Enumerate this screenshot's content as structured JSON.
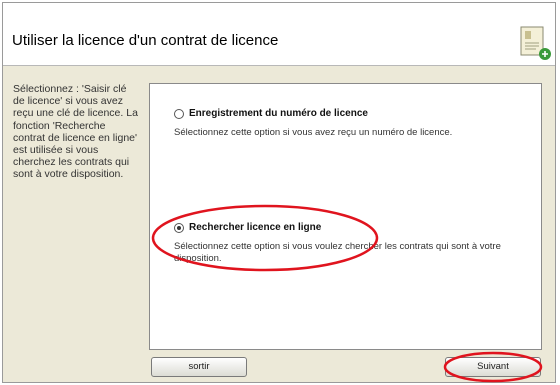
{
  "window": {
    "title": "Utiliser la licence d'un contrat de licence",
    "header_icon": "license-document-icon"
  },
  "sidebar": {
    "instructions": "Sélectionnez : 'Saisir clé de licence' si vous avez reçu une clé de licence. La fonction 'Recherche contrat de licence en ligne' est utilisée si vous cherchez les contrats qui sont à votre disposition."
  },
  "options": [
    {
      "label": "Enregistrement du numéro de licence",
      "description": "Sélectionnez cette option si vous avez reçu un numéro de licence.",
      "selected": false
    },
    {
      "label": "Rechercher licence en ligne",
      "description": "Sélectionnez cette option si vous voulez chercher les contrats qui sont à votre disposition.",
      "selected": true
    }
  ],
  "buttons": {
    "exit_label": "sortir",
    "next_label": "Suivant"
  },
  "colors": {
    "annotation": "#e0141e",
    "window_bg": "#ece9d8"
  }
}
